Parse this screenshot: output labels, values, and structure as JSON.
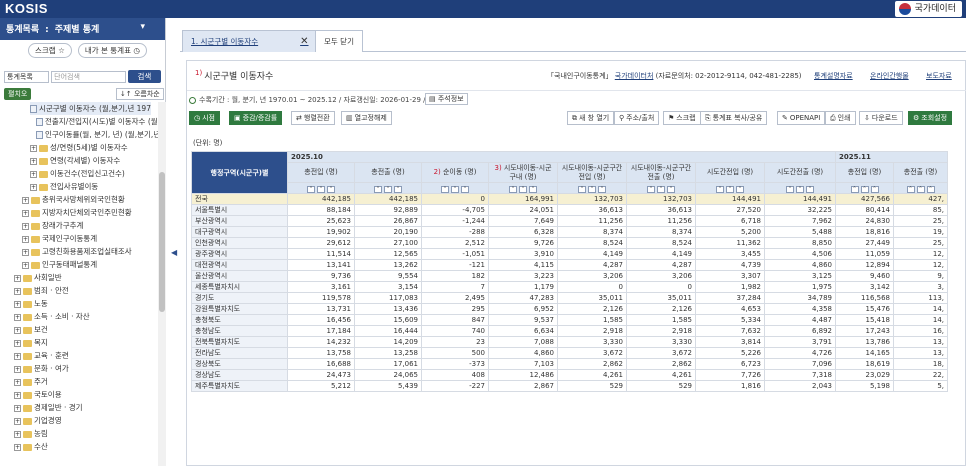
{
  "app": {
    "logo": "KOSIS",
    "gov_label": "국가데이터"
  },
  "sidebar": {
    "title": "통계목록",
    "sep": ":",
    "subject": "주제별 통계",
    "quick": [
      "스크랩 ☆",
      "내가 본 통계표 ◷"
    ],
    "search": {
      "select": "통계목록",
      "placeholder": "단어검색",
      "button": "검색"
    },
    "expand_label": "펼치오",
    "sort_label": "오름차순",
    "tree": [
      {
        "label": "시군구별 이동자수 (월,분기,년 197",
        "type": "doc",
        "indent": 30,
        "current": true
      },
      {
        "label": "전출지/전입지(시도)별 이동자수 (월",
        "type": "doc",
        "indent": 36
      },
      {
        "label": "인구이동률(월, 분기, 년) (월,분기,년",
        "type": "doc",
        "indent": 36
      },
      {
        "label": "성/연령(5세)별 이동자수",
        "type": "folder",
        "indent": 30,
        "pm": "+"
      },
      {
        "label": "연령(각세별) 이동자수",
        "type": "folder",
        "indent": 30,
        "pm": "+"
      },
      {
        "label": "이동건수(전입신고건수)",
        "type": "folder",
        "indent": 30,
        "pm": "+"
      },
      {
        "label": "전입사유별이동",
        "type": "folder",
        "indent": 30,
        "pm": "+"
      },
      {
        "label": "층위국사망체위외국인현황",
        "type": "folder",
        "indent": 22,
        "pm": "+"
      },
      {
        "label": "지방자치단체외국인주민현황",
        "type": "folder",
        "indent": 22,
        "pm": "+"
      },
      {
        "label": "장래가구추계",
        "type": "folder",
        "indent": 22,
        "pm": "+"
      },
      {
        "label": "국제인구이동통계",
        "type": "folder",
        "indent": 22,
        "pm": "+"
      },
      {
        "label": "고령친화용품제조업실태조사",
        "type": "folder",
        "indent": 22,
        "pm": "+"
      },
      {
        "label": "인구동태패널통계",
        "type": "folder",
        "indent": 22,
        "pm": "+"
      },
      {
        "label": "사회일반",
        "type": "folder",
        "indent": 14,
        "pm": "+"
      },
      {
        "label": "범죄 · 안전",
        "type": "folder",
        "indent": 14,
        "pm": "+"
      },
      {
        "label": "노동",
        "type": "folder",
        "indent": 14,
        "pm": "+"
      },
      {
        "label": "소득 · 소비 · 자산",
        "type": "folder",
        "indent": 14,
        "pm": "+"
      },
      {
        "label": "보건",
        "type": "folder",
        "indent": 14,
        "pm": "+"
      },
      {
        "label": "복지",
        "type": "folder",
        "indent": 14,
        "pm": "+"
      },
      {
        "label": "교육 · 훈련",
        "type": "folder",
        "indent": 14,
        "pm": "+"
      },
      {
        "label": "문화 · 여가",
        "type": "folder",
        "indent": 14,
        "pm": "+"
      },
      {
        "label": "주거",
        "type": "folder",
        "indent": 14,
        "pm": "+"
      },
      {
        "label": "국토이용",
        "type": "folder",
        "indent": 14,
        "pm": "+"
      },
      {
        "label": "경제일반 · 경기",
        "type": "folder",
        "indent": 14,
        "pm": "+"
      },
      {
        "label": "기업경영",
        "type": "folder",
        "indent": 14,
        "pm": "+"
      },
      {
        "label": "농림",
        "type": "folder",
        "indent": 14,
        "pm": "+"
      },
      {
        "label": "수산",
        "type": "folder",
        "indent": 14,
        "pm": "+"
      }
    ]
  },
  "tabs": {
    "active": "1. 시군구별 이동자수",
    "close": "✕",
    "close_all": "모두 닫기"
  },
  "table_header": {
    "num": "1)",
    "title": "시군구별 이동자수",
    "source_prefix": "「국내인구이동통계」",
    "source_link": "국가데이터처",
    "contact": "(자료문의처: 02-2012-9114, 042-481-2285)",
    "links": [
      "통계설명자료",
      "온라인간행물",
      "보도자료"
    ],
    "period": "수록기간 : 월, 분기, 년 1970.01 ~ 2025.12 / 자료갱신일: 2026-01-29 /",
    "notes": "주석정보"
  },
  "toolbar": {
    "left": [
      "시점",
      "증감/증감률",
      "행렬전환",
      "열고정해제"
    ],
    "right": [
      "새 창 열기",
      "주소/출처",
      "스크랩",
      "통계표 복사/공유",
      "OPENAPI",
      "인쇄",
      "다운로드",
      "조회설정"
    ]
  },
  "unit": "(단위: 명)",
  "grid": {
    "region_header": "행정구역(시군구)별",
    "periods": [
      "2025.10",
      "2025.11"
    ],
    "columns": [
      {
        "num": "",
        "label": "총전입 (명)"
      },
      {
        "num": "",
        "label": "총전출 (명)"
      },
      {
        "num": "2)",
        "label": "순이동 (명)"
      },
      {
        "num": "3)",
        "label": "시도내이동-시군구내 (명)"
      },
      {
        "num": "",
        "label": "시도내이동-시군구간 전입 (명)"
      },
      {
        "num": "",
        "label": "시도내이동-시군구간 전출 (명)"
      },
      {
        "num": "",
        "label": "시도간전입 (명)"
      },
      {
        "num": "",
        "label": "시도간전출 (명)"
      },
      {
        "num": "",
        "label": "총전입 (명)"
      },
      {
        "num": "",
        "label": "총전출 (명)"
      }
    ],
    "sort_buttons": "^ ^ ^",
    "rows": [
      {
        "name": "전국",
        "v": [
          "442,185",
          "442,185",
          "0",
          "164,991",
          "132,703",
          "132,703",
          "144,491",
          "144,491",
          "427,566",
          "427,"
        ]
      },
      {
        "name": "서울특별시",
        "v": [
          "88,184",
          "92,889",
          "-4,705",
          "24,051",
          "36,613",
          "36,613",
          "27,520",
          "32,225",
          "80,414",
          "85,"
        ]
      },
      {
        "name": "부산광역시",
        "v": [
          "25,623",
          "26,867",
          "-1,244",
          "7,649",
          "11,256",
          "11,256",
          "6,718",
          "7,962",
          "24,830",
          "25,"
        ]
      },
      {
        "name": "대구광역시",
        "v": [
          "19,902",
          "20,190",
          "-288",
          "6,328",
          "8,374",
          "8,374",
          "5,200",
          "5,488",
          "18,816",
          "19,"
        ]
      },
      {
        "name": "인천광역시",
        "v": [
          "29,612",
          "27,100",
          "2,512",
          "9,726",
          "8,524",
          "8,524",
          "11,362",
          "8,850",
          "27,449",
          "25,"
        ]
      },
      {
        "name": "광주광역시",
        "v": [
          "11,514",
          "12,565",
          "-1,051",
          "3,910",
          "4,149",
          "4,149",
          "3,455",
          "4,506",
          "11,059",
          "12,"
        ]
      },
      {
        "name": "대전광역시",
        "v": [
          "13,141",
          "13,262",
          "-121",
          "4,115",
          "4,287",
          "4,287",
          "4,739",
          "4,860",
          "12,894",
          "12,"
        ]
      },
      {
        "name": "울산광역시",
        "v": [
          "9,736",
          "9,554",
          "182",
          "3,223",
          "3,206",
          "3,206",
          "3,307",
          "3,125",
          "9,460",
          "9,"
        ]
      },
      {
        "name": "세종특별자치시",
        "v": [
          "3,161",
          "3,154",
          "7",
          "1,179",
          "0",
          "0",
          "1,982",
          "1,975",
          "3,142",
          "3,"
        ]
      },
      {
        "name": "경기도",
        "v": [
          "119,578",
          "117,083",
          "2,495",
          "47,283",
          "35,011",
          "35,011",
          "37,284",
          "34,789",
          "116,568",
          "113,"
        ]
      },
      {
        "name": "강원특별자치도",
        "v": [
          "13,731",
          "13,436",
          "295",
          "6,952",
          "2,126",
          "2,126",
          "4,653",
          "4,358",
          "15,476",
          "14,"
        ]
      },
      {
        "name": "충청북도",
        "v": [
          "16,456",
          "15,609",
          "847",
          "9,537",
          "1,585",
          "1,585",
          "5,334",
          "4,487",
          "15,418",
          "14,"
        ]
      },
      {
        "name": "충청남도",
        "v": [
          "17,184",
          "16,444",
          "740",
          "6,634",
          "2,918",
          "2,918",
          "7,632",
          "6,892",
          "17,243",
          "16,"
        ]
      },
      {
        "name": "전북특별자치도",
        "v": [
          "14,232",
          "14,209",
          "23",
          "7,088",
          "3,330",
          "3,330",
          "3,814",
          "3,791",
          "13,786",
          "13,"
        ]
      },
      {
        "name": "전라남도",
        "v": [
          "13,758",
          "13,258",
          "500",
          "4,860",
          "3,672",
          "3,672",
          "5,226",
          "4,726",
          "14,165",
          "13,"
        ]
      },
      {
        "name": "경상북도",
        "v": [
          "16,688",
          "17,061",
          "-373",
          "7,103",
          "2,862",
          "2,862",
          "6,723",
          "7,096",
          "18,619",
          "18,"
        ]
      },
      {
        "name": "경상남도",
        "v": [
          "24,473",
          "24,065",
          "408",
          "12,486",
          "4,261",
          "4,261",
          "7,726",
          "7,318",
          "23,029",
          "22,"
        ]
      },
      {
        "name": "제주특별자치도",
        "v": [
          "5,212",
          "5,439",
          "-227",
          "2,867",
          "529",
          "529",
          "1,816",
          "2,043",
          "5,198",
          "5,"
        ]
      }
    ]
  }
}
